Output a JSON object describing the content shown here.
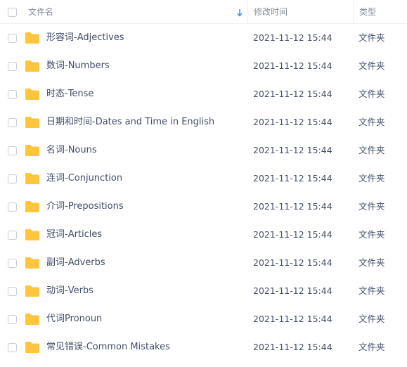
{
  "header": {
    "name_label": "文件名",
    "time_label": "修改时间",
    "type_label": "类型",
    "sort_icon": "arrow-down-icon"
  },
  "colors": {
    "folder": "#ffc53d",
    "sort_arrow": "#1e90ff",
    "text": "#424e67",
    "header_text": "#878c9c"
  },
  "files": [
    {
      "name": "形容词-Adjectives",
      "time": "2021-11-12 15:44",
      "type": "文件夹"
    },
    {
      "name": "数词-Numbers",
      "time": "2021-11-12 15:44",
      "type": "文件夹"
    },
    {
      "name": "时态-Tense",
      "time": "2021-11-12 15:44",
      "type": "文件夹"
    },
    {
      "name": "日期和时间-Dates and Time in English",
      "time": "2021-11-12 15:44",
      "type": "文件夹"
    },
    {
      "name": "名词-Nouns",
      "time": "2021-11-12 15:44",
      "type": "文件夹"
    },
    {
      "name": "连词-Conjunction",
      "time": "2021-11-12 15:44",
      "type": "文件夹"
    },
    {
      "name": "介词-Prepositions",
      "time": "2021-11-12 15:44",
      "type": "文件夹"
    },
    {
      "name": "冠词-Articles",
      "time": "2021-11-12 15:44",
      "type": "文件夹"
    },
    {
      "name": "副词-Adverbs",
      "time": "2021-11-12 15:44",
      "type": "文件夹"
    },
    {
      "name": "动词-Verbs",
      "time": "2021-11-12 15:44",
      "type": "文件夹"
    },
    {
      "name": "代词Pronoun",
      "time": "2021-11-12 15:44",
      "type": "文件夹"
    },
    {
      "name": "常见错误-Common Mistakes",
      "time": "2021-11-12 15:44",
      "type": "文件夹"
    }
  ]
}
